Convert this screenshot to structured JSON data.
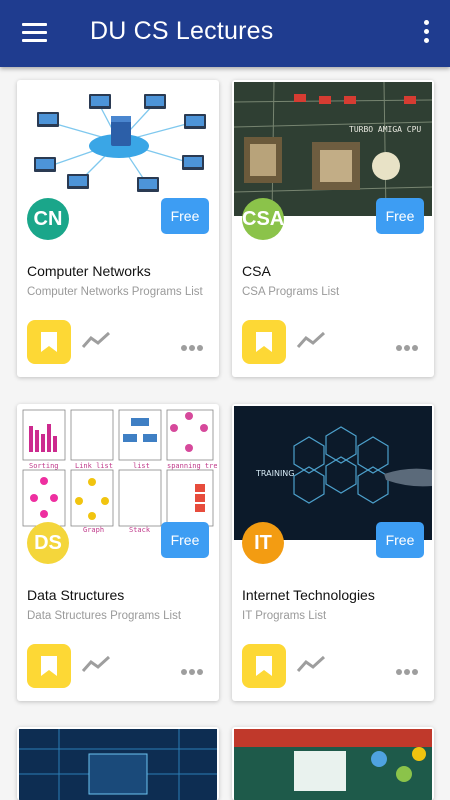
{
  "app": {
    "title": "DU CS Lectures"
  },
  "cards": [
    {
      "abbr": "CN",
      "title": "Computer Networks",
      "subtitle": "Computer Networks Programs List",
      "badge": "Free",
      "avatar_color": "#1aa68a"
    },
    {
      "abbr": "CSA",
      "title": "CSA",
      "subtitle": "CSA Programs List",
      "badge": "Free",
      "avatar_color": "#8bc34a"
    },
    {
      "abbr": "DS",
      "title": "Data Structures",
      "subtitle": "Data Structures Programs List",
      "badge": "Free",
      "avatar_color": "#f4d63b"
    },
    {
      "abbr": "IT",
      "title": "Internet Technologies",
      "subtitle": "IT Programs List",
      "badge": "Free",
      "avatar_color": "#f39c12"
    }
  ],
  "thumb_labels": {
    "csa_chip": "TURBO AMIGA CPU",
    "ds": [
      "Sorting",
      "Link list",
      "list",
      "spanning tree",
      "Graph",
      "Stack"
    ],
    "it": [
      "TRAINING"
    ]
  },
  "colors": {
    "appbar": "#1f3c8f",
    "free_badge": "#3d9df3",
    "bookmark": "#fdd835"
  }
}
